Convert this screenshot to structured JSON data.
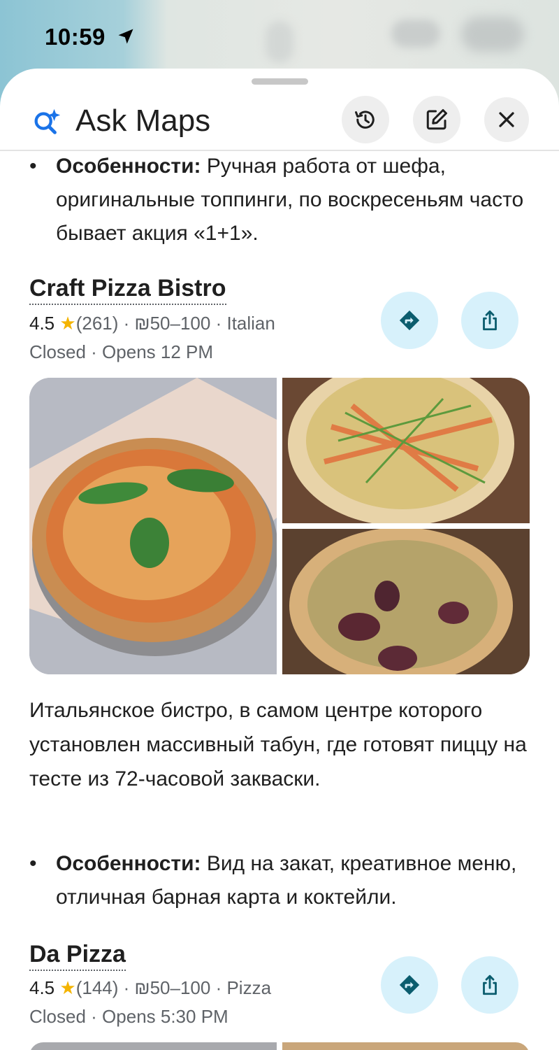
{
  "status_bar": {
    "time": "10:59"
  },
  "header": {
    "title": "Ask Maps"
  },
  "intro_bullet": {
    "label": "Особенности:",
    "text": " Ручная работа от шефа, оригинальные топпинги, по воскресеньям часто бывает акция «1+1»."
  },
  "places": [
    {
      "name": "Craft Pizza Bistro",
      "rating": "4.5",
      "reviews": "(261)",
      "price": "₪50–100",
      "category": "Italian",
      "status": "Closed",
      "opens": "Opens 12 PM",
      "description": "Итальянское бистро, в самом центре которого установлен массивный табун, где готовят пиццу на тесте из 72-часовой закваски.",
      "bullet_label": "Особенности:",
      "bullet_text": " Вид на закат, креативное меню, отличная барная карта и коктейли."
    },
    {
      "name": "Da Pizza",
      "rating": "4.5",
      "reviews": "(144)",
      "price": "₪50–100",
      "category": "Pizza",
      "status": "Closed",
      "opens": "Opens 5:30 PM"
    }
  ],
  "colors": {
    "accent_blue": "#1a73e8",
    "action_bg": "#d7f1fb",
    "action_icon": "#0b5d6e",
    "star": "#f4b400"
  }
}
